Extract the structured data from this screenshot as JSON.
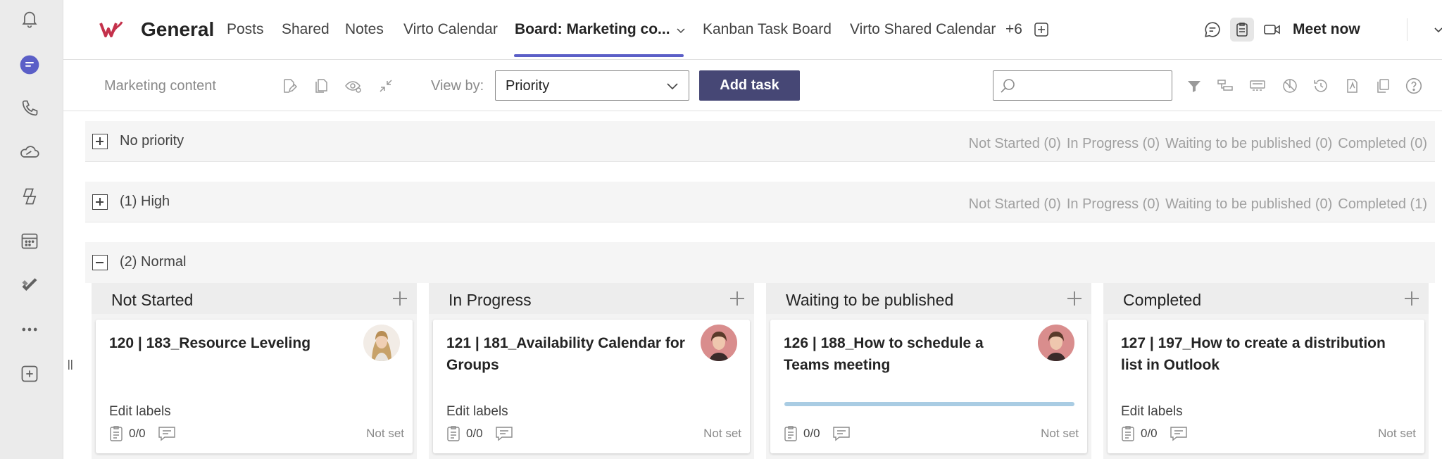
{
  "rail": {
    "items": [
      "activity",
      "chat",
      "calls",
      "onedrive",
      "copilot",
      "calendar",
      "planner",
      "more-apps",
      "add-apps"
    ]
  },
  "header": {
    "channel_title": "General",
    "tabs": [
      {
        "label": "Posts"
      },
      {
        "label": "Shared"
      },
      {
        "label": "Notes"
      },
      {
        "label": "Virto Calendar"
      },
      {
        "label": "Board: Marketing co..."
      },
      {
        "label": "Kanban Task Board"
      },
      {
        "label": "Virto Shared Calendar"
      }
    ],
    "more_tabs": "+6",
    "meet_now": "Meet now"
  },
  "toolbar": {
    "board_name": "Marketing content",
    "view_by_label": "View by:",
    "view_by_value": "Priority",
    "add_task": "Add task",
    "search_value": ""
  },
  "groups": [
    {
      "name": "No priority",
      "stats": [
        "Not Started (0)",
        "In Progress (0)",
        "Waiting to be published (0)",
        "Completed (0)"
      ]
    },
    {
      "name": "(1) High",
      "stats": [
        "Not Started (0)",
        "In Progress (0)",
        "Waiting to be published (0)",
        "Completed (1)"
      ]
    },
    {
      "name": "(2) Normal"
    }
  ],
  "columns": [
    {
      "title": "Not Started",
      "card": {
        "title": "120 | 183_Resource Leveling",
        "labels": "Edit labels",
        "count": "0/0",
        "due": "Not set"
      }
    },
    {
      "title": "In Progress",
      "card": {
        "title": "121 | 181_Availability Calendar for Groups",
        "labels": "Edit labels",
        "count": "0/0",
        "due": "Not set"
      }
    },
    {
      "title": "Waiting to be published",
      "card": {
        "title": "126 | 188_How to schedule a Teams meeting",
        "labels": "",
        "count": "0/0",
        "due": "Not set",
        "progress": 1.0
      }
    },
    {
      "title": "Completed",
      "card": {
        "title": "127 | 197_How to create a distribution list in Outlook",
        "labels": "Edit labels",
        "count": "0/0",
        "due": "Not set"
      }
    }
  ],
  "colors": {
    "accent": "#5b5fc7",
    "add_task_bg": "#464775",
    "brand_logo": "#c4314b",
    "progress": "#a9cce3"
  }
}
